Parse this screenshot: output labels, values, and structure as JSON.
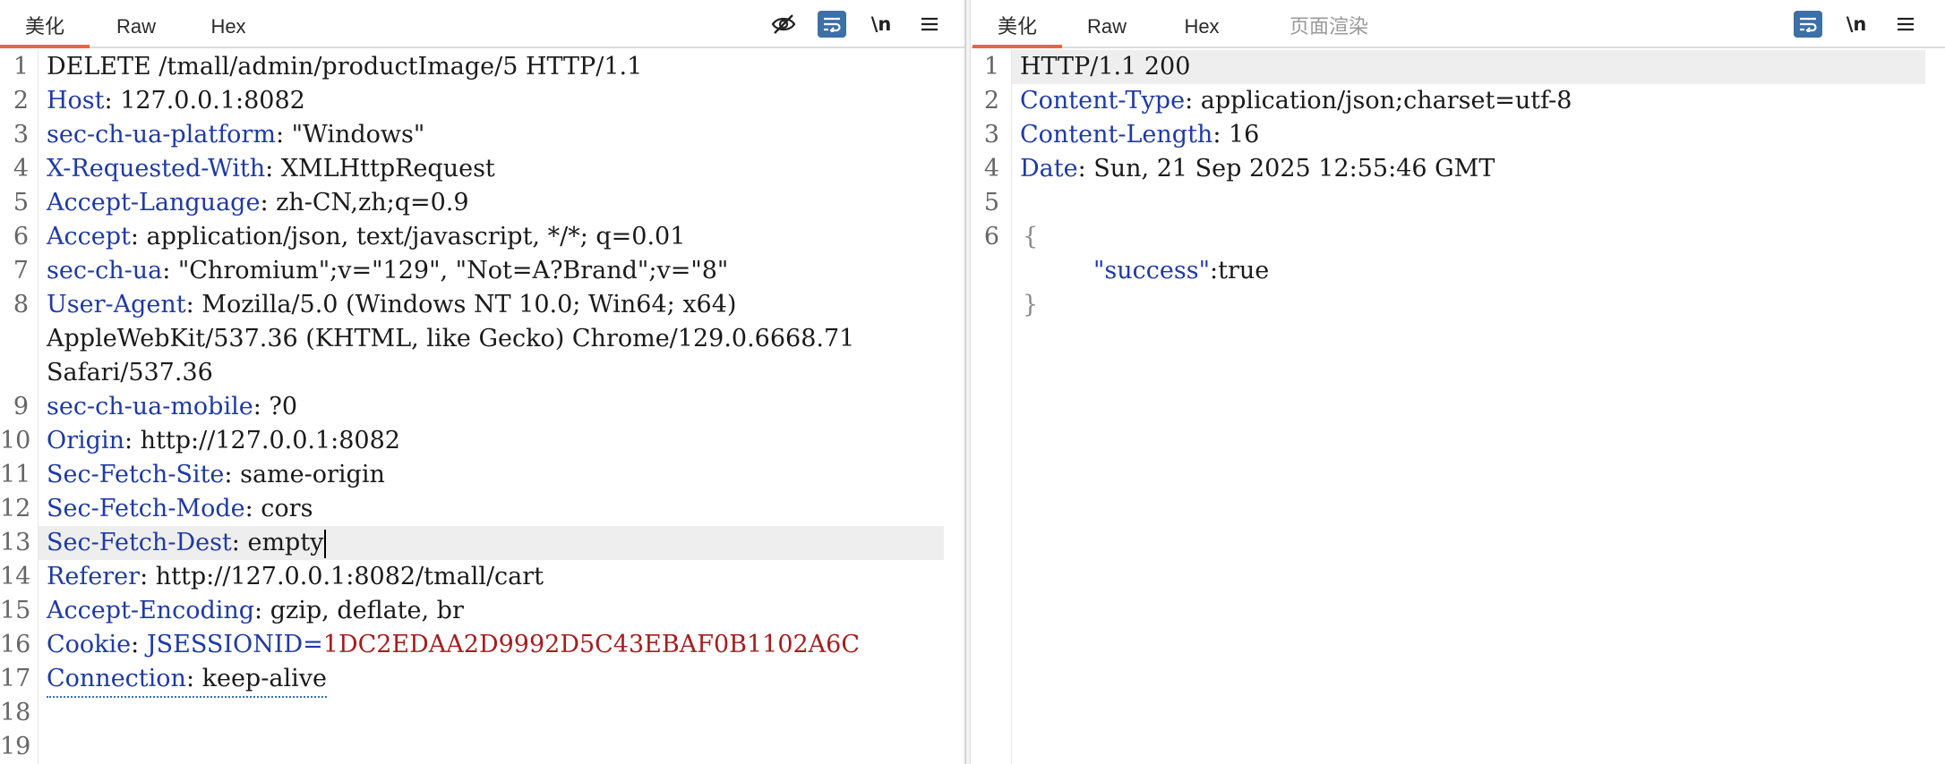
{
  "request_tabs": [
    "美化",
    "Raw",
    "Hex"
  ],
  "response_tabs": [
    "美化",
    "Raw",
    "Hex",
    "页面渲染"
  ],
  "toolbar": {
    "newline_label": "\\n"
  },
  "request": {
    "start_line": "DELETE /tmall/admin/productImage/5 HTTP/1.1",
    "headers": [
      {
        "n": "2",
        "k": "Host",
        "v": ": 127.0.0.1:8082"
      },
      {
        "n": "3",
        "k": "sec-ch-ua-platform",
        "v": ": \"Windows\""
      },
      {
        "n": "4",
        "k": "X-Requested-With",
        "v": ": XMLHttpRequest"
      },
      {
        "n": "5",
        "k": "Accept-Language",
        "v": ": zh-CN,zh;q=0.9"
      },
      {
        "n": "6",
        "k": "Accept",
        "v": ": application/json, text/javascript, */*; q=0.01"
      },
      {
        "n": "7",
        "k": "sec-ch-ua",
        "v": ": \"Chromium\";v=\"129\", \"Not=A?Brand\";v=\"8\""
      }
    ],
    "ua_key": "User-Agent",
    "ua_lines": [
      ": Mozilla/5.0 (Windows NT 10.0; Win64; x64)",
      "AppleWebKit/537.36 (KHTML, like Gecko) Chrome/129.0.6668.71",
      "Safari/537.36"
    ],
    "headers2": [
      {
        "n": "9",
        "k": "sec-ch-ua-mobile",
        "v": ": ?0"
      },
      {
        "n": "10",
        "k": "Origin",
        "v": ": http://127.0.0.1:8082"
      },
      {
        "n": "11",
        "k": "Sec-Fetch-Site",
        "v": ": same-origin"
      },
      {
        "n": "12",
        "k": "Sec-Fetch-Mode",
        "v": ": cors"
      },
      {
        "n": "13",
        "k": "Sec-Fetch-Dest",
        "v": ": empty"
      },
      {
        "n": "14",
        "k": "Referer",
        "v": ": http://127.0.0.1:8082/tmall/cart"
      },
      {
        "n": "15",
        "k": "Accept-Encoding",
        "v": ": gzip, deflate, br"
      }
    ],
    "cookie_key": "Cookie",
    "cookie_name": "JSESSIONID",
    "cookie_value": "1DC2EDAA2D9992D5C43EBAF0B1102A6C",
    "connection_key": "Connection",
    "connection_value": ": keep-alive",
    "line_numbers": [
      "1",
      "8",
      "16",
      "17",
      "18",
      "19"
    ]
  },
  "response": {
    "status_line": "HTTP/1.1 200",
    "headers": [
      {
        "n": "2",
        "k": "Content-Type",
        "v": ": application/json;charset=utf-8"
      },
      {
        "n": "3",
        "k": "Content-Length",
        "v": ": 16"
      },
      {
        "n": "4",
        "k": "Date",
        "v": ": Sun, 21 Sep 2025 12:55:46 GMT"
      }
    ],
    "line_numbers": [
      "1",
      "5",
      "6"
    ],
    "brace_open": "{",
    "json_key": "\"success\"",
    "json_rest": ":true",
    "brace_close": "}"
  },
  "colors": {
    "accent": "#e8663d",
    "header_key": "#1f3aa3",
    "cookie_value": "#a41e1e",
    "wrap_button": "#3d6fa8"
  }
}
